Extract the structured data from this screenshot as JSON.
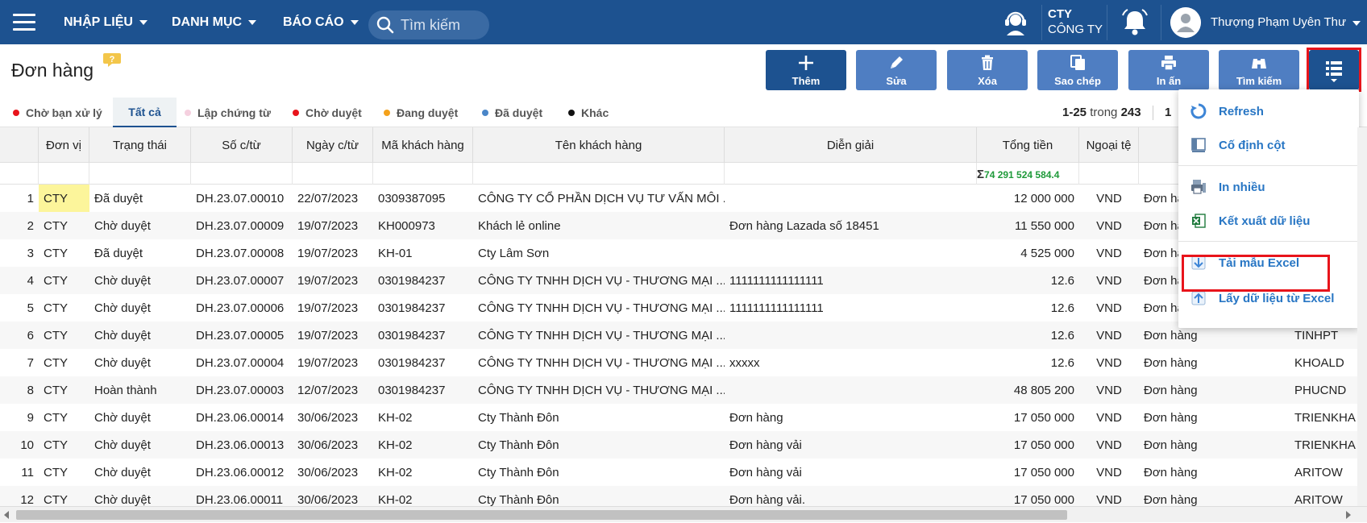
{
  "nav": {
    "menu_input": "NHẬP LIỆU",
    "menu_catalog": "DANH MỤC",
    "menu_report": "BÁO CÁO",
    "search_placeholder": "Tìm kiếm",
    "company_code": "CTY",
    "company_name": "CÔNG TY",
    "user_name": "Thượng Phạm Uyên Thư"
  },
  "page": {
    "title": "Đơn hàng",
    "help_glyph": "?"
  },
  "toolbar": {
    "add": "Thêm",
    "edit": "Sửa",
    "delete": "Xóa",
    "copy": "Sao chép",
    "print": "In ấn",
    "find": "Tìm kiếm"
  },
  "filters": [
    {
      "label": "Chờ bạn xử lý",
      "color": "#e8141b"
    },
    {
      "label": "Tất cả",
      "color": ""
    },
    {
      "label": "Lập chứng từ",
      "color": "#f5d0df"
    },
    {
      "label": "Chờ duyệt",
      "color": "#e8141b"
    },
    {
      "label": "Đang duyệt",
      "color": "#f4a11b"
    },
    {
      "label": "Đã duyệt",
      "color": "#4a86c8"
    },
    {
      "label": "Khác",
      "color": "#111111"
    }
  ],
  "pager": {
    "range": "1-25",
    "of_word": "trong",
    "total": "243",
    "page_fragment": "1"
  },
  "table": {
    "columns": [
      "Đơn vị",
      "Trạng thái",
      "Số c/từ",
      "Ngày c/từ",
      "Mã khách hàng",
      "Tên khách hàng",
      "Diễn giải",
      "Tổng tiền",
      "Ngoại tệ"
    ],
    "sum_symbol": "Σ",
    "sum_total": "74 291 524 584.4",
    "rows": [
      {
        "no": "1",
        "unit": "CTY",
        "status": "Đã duyệt",
        "doc": "DH.23.07.00010",
        "date": "22/07/2023",
        "cust_code": "0309387095",
        "cust_name": "CÔNG TY CỔ PHẦN DỊCH VỤ TƯ VẤN MÔI ...",
        "desc": "",
        "total": "12 000 000",
        "cur": "VND",
        "type": "Đơn hà",
        "user": ""
      },
      {
        "no": "2",
        "unit": "CTY",
        "status": "Chờ duyệt",
        "doc": "DH.23.07.00009",
        "date": "19/07/2023",
        "cust_code": "KH000973",
        "cust_name": "Khách lẻ online",
        "desc": "Đơn hàng Lazada số 18451",
        "total": "11 550 000",
        "cur": "VND",
        "type": "Đơn hà",
        "user": ""
      },
      {
        "no": "3",
        "unit": "CTY",
        "status": "Đã duyệt",
        "doc": "DH.23.07.00008",
        "date": "19/07/2023",
        "cust_code": "KH-01",
        "cust_name": "Cty Lâm Sơn",
        "desc": "",
        "total": "4 525 000",
        "cur": "VND",
        "type": "Đơn hà",
        "user": ""
      },
      {
        "no": "4",
        "unit": "CTY",
        "status": "Chờ duyệt",
        "doc": "DH.23.07.00007",
        "date": "19/07/2023",
        "cust_code": "0301984237",
        "cust_name": "CÔNG TY TNHH DỊCH VỤ - THƯƠNG MẠI ...",
        "desc": "1111111111111111",
        "total": "12.6",
        "cur": "VND",
        "type": "Đơn hà",
        "user": ""
      },
      {
        "no": "5",
        "unit": "CTY",
        "status": "Chờ duyệt",
        "doc": "DH.23.07.00006",
        "date": "19/07/2023",
        "cust_code": "0301984237",
        "cust_name": "CÔNG TY TNHH DỊCH VỤ - THƯƠNG MẠI ...",
        "desc": "1111111111111111",
        "total": "12.6",
        "cur": "VND",
        "type": "Đơn hà",
        "user": ""
      },
      {
        "no": "6",
        "unit": "CTY",
        "status": "Chờ duyệt",
        "doc": "DH.23.07.00005",
        "date": "19/07/2023",
        "cust_code": "0301984237",
        "cust_name": "CÔNG TY TNHH DỊCH VỤ - THƯƠNG MẠI ...",
        "desc": "",
        "total": "12.6",
        "cur": "VND",
        "type": "Đơn hàng",
        "user": "TINHPT"
      },
      {
        "no": "7",
        "unit": "CTY",
        "status": "Chờ duyệt",
        "doc": "DH.23.07.00004",
        "date": "19/07/2023",
        "cust_code": "0301984237",
        "cust_name": "CÔNG TY TNHH DỊCH VỤ - THƯƠNG MẠI ...",
        "desc": "xxxxx",
        "total": "12.6",
        "cur": "VND",
        "type": "Đơn hàng",
        "user": "KHOALD"
      },
      {
        "no": "8",
        "unit": "CTY",
        "status": "Hoàn thành",
        "doc": "DH.23.07.00003",
        "date": "12/07/2023",
        "cust_code": "0301984237",
        "cust_name": "CÔNG TY TNHH DỊCH VỤ - THƯƠNG MẠI ...",
        "desc": "",
        "total": "48 805 200",
        "cur": "VND",
        "type": "Đơn hàng",
        "user": "PHUCND"
      },
      {
        "no": "9",
        "unit": "CTY",
        "status": "Chờ duyệt",
        "doc": "DH.23.06.00014",
        "date": "30/06/2023",
        "cust_code": "KH-02",
        "cust_name": "Cty Thành Đôn",
        "desc": "Đơn hàng",
        "total": "17 050 000",
        "cur": "VND",
        "type": "Đơn hàng",
        "user": "TRIENKHA"
      },
      {
        "no": "10",
        "unit": "CTY",
        "status": "Chờ duyệt",
        "doc": "DH.23.06.00013",
        "date": "30/06/2023",
        "cust_code": "KH-02",
        "cust_name": "Cty Thành Đôn",
        "desc": "Đơn hàng vải",
        "total": "17 050 000",
        "cur": "VND",
        "type": "Đơn hàng",
        "user": "TRIENKHA"
      },
      {
        "no": "11",
        "unit": "CTY",
        "status": "Chờ duyệt",
        "doc": "DH.23.06.00012",
        "date": "30/06/2023",
        "cust_code": "KH-02",
        "cust_name": "Cty Thành Đôn",
        "desc": "Đơn hàng vải",
        "total": "17 050 000",
        "cur": "VND",
        "type": "Đơn hàng",
        "user": "ARITOW"
      },
      {
        "no": "12",
        "unit": "CTY",
        "status": "Chờ duyệt",
        "doc": "DH.23.06.00011",
        "date": "30/06/2023",
        "cust_code": "KH-02",
        "cust_name": "Cty Thành Đôn",
        "desc": "Đơn hàng vải.",
        "total": "17 050 000",
        "cur": "VND",
        "type": "Đơn hàng",
        "user": "ARITOW"
      }
    ]
  },
  "dropdown": {
    "refresh": "Refresh",
    "freeze": "Cố định cột",
    "print_many": "In nhiều",
    "export": "Kết xuất dữ liệu",
    "download_template": "Tải mẫu Excel",
    "import_excel": "Lấy dữ liệu từ Excel"
  },
  "colors": {
    "nav_bg": "#1d5290",
    "button_bg": "#4f7ec2",
    "highlight_outline": "#e8141b",
    "link_blue": "#2876c4",
    "sum_green": "#1f9a3a",
    "unit_highlight": "#fcf59b"
  },
  "icons": [
    "hamburger-icon",
    "search-icon",
    "headset-icon",
    "bell-icon",
    "avatar-icon",
    "help-icon",
    "plus-icon",
    "pencil-icon",
    "trash-icon",
    "copy-icon",
    "printer-icon",
    "binoculars-icon",
    "list-menu-icon",
    "refresh-icon",
    "pin-column-icon",
    "print-many-icon",
    "excel-icon",
    "download-icon",
    "upload-icon"
  ]
}
